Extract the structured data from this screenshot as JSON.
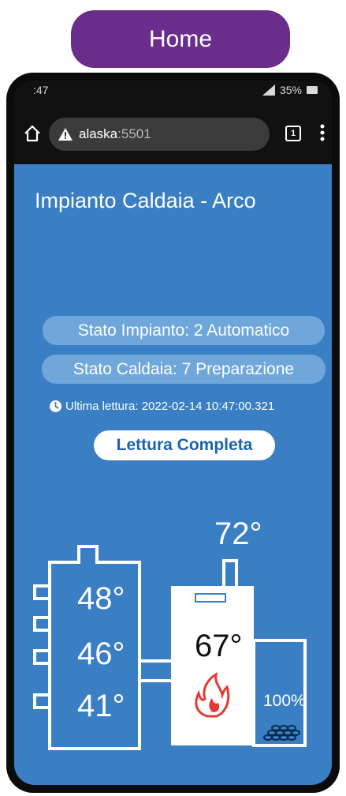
{
  "header": {
    "home_label": "Home"
  },
  "status": {
    "time": ":47",
    "battery": "35%"
  },
  "browser": {
    "url_host": "alaska",
    "url_port": ":5501",
    "tab_count": "1"
  },
  "app": {
    "title": "Impianto Caldaia - Arco",
    "plant_state": "Stato Impianto: 2 Automatico",
    "boiler_state": "Stato Caldaia: 7 Preparazione",
    "last_read": "Ultima lettura: 2022-02-14 10:47:00.321",
    "full_read_button": "Lettura Completa"
  },
  "readings": {
    "flue_temp": "72°",
    "tank_top": "48°",
    "tank_mid": "46°",
    "tank_bottom": "41°",
    "boiler_temp": "67°",
    "pellet_level": "100%"
  },
  "colors": {
    "background": "#3a7fc3",
    "accent": "#6b2d8c",
    "pill": "#6fa7da",
    "flame": "#e53935"
  }
}
